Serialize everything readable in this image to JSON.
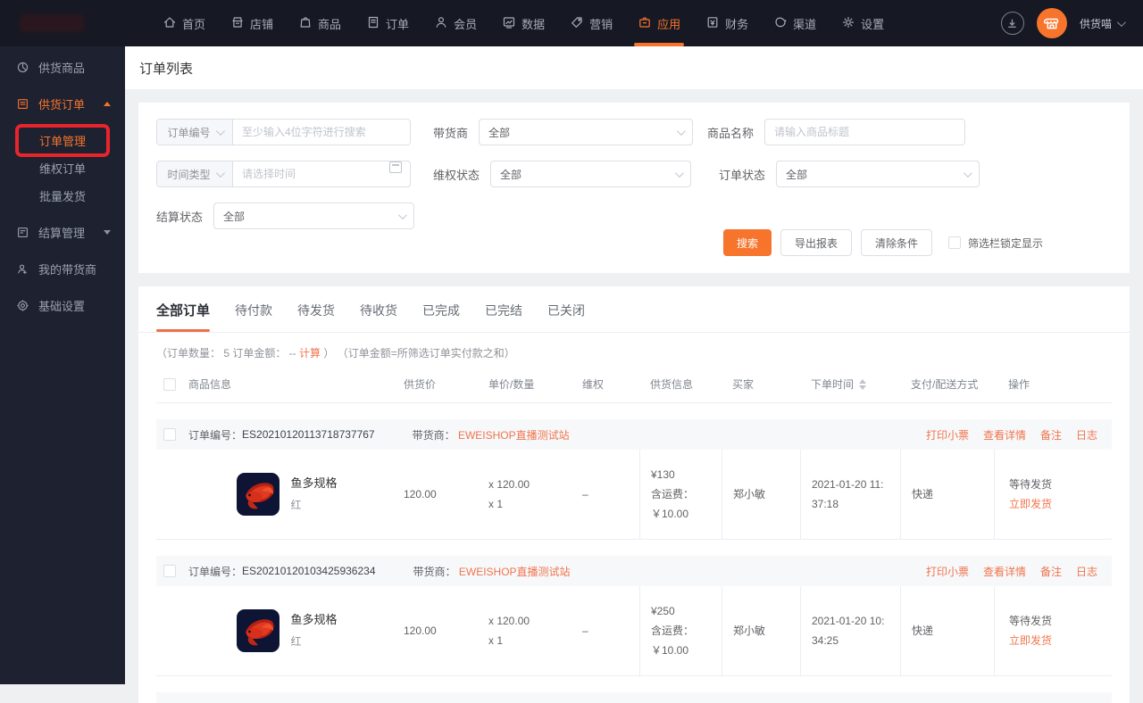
{
  "colors": {
    "accent": "#f7742c",
    "link_orange": "#f0754e",
    "topbar_bg": "#161823",
    "sidebar_bg": "#1d2130",
    "annotation_red": "#e7252b",
    "page_bg": "#eff0f2"
  },
  "topnav": {
    "items": [
      {
        "label": "首页",
        "icon": "home-icon"
      },
      {
        "label": "店铺",
        "icon": "shop-icon"
      },
      {
        "label": "商品",
        "icon": "goods-icon"
      },
      {
        "label": "订单",
        "icon": "order-icon"
      },
      {
        "label": "会员",
        "icon": "member-icon"
      },
      {
        "label": "数据",
        "icon": "data-icon"
      },
      {
        "label": "营销",
        "icon": "marketing-icon"
      },
      {
        "label": "应用",
        "icon": "app-icon",
        "active": true
      },
      {
        "label": "财务",
        "icon": "finance-icon"
      },
      {
        "label": "渠道",
        "icon": "channel-icon"
      },
      {
        "label": "设置",
        "icon": "settings-icon"
      }
    ],
    "user": {
      "name": "供货喵"
    }
  },
  "sidebar": {
    "items": [
      {
        "label": "供货商品"
      },
      {
        "label": "供货订单",
        "expanded": true,
        "active": true
      },
      {
        "label": "订单管理",
        "child": true,
        "active": true,
        "annotated": true
      },
      {
        "label": "维权订单",
        "child": true
      },
      {
        "label": "批量发货",
        "child": true
      },
      {
        "label": "结算管理",
        "collapsed": true
      },
      {
        "label": "我的带货商"
      },
      {
        "label": "基础设置"
      }
    ]
  },
  "page": {
    "title": "订单列表"
  },
  "filters": {
    "order_no": {
      "selector": "订单编号",
      "placeholder": "至少输入4位字符进行搜索"
    },
    "daihuoshang": {
      "label": "带货商",
      "value": "全部"
    },
    "product_name": {
      "label": "商品名称",
      "placeholder": "请输入商品标题"
    },
    "time_type": {
      "selector": "时间类型",
      "placeholder": "请选择时间"
    },
    "weiquan_status": {
      "label": "维权状态",
      "value": "全部"
    },
    "order_status": {
      "label": "订单状态",
      "value": "全部"
    },
    "settle_status": {
      "label": "结算状态",
      "value": "全部"
    },
    "search_button": "搜索",
    "export_button": "导出报表",
    "clear_button": "清除条件",
    "lock_label": "筛选栏锁定显示"
  },
  "tabs": [
    {
      "label": "全部订单",
      "active": true
    },
    {
      "label": "待付款"
    },
    {
      "label": "待发货"
    },
    {
      "label": "待收货"
    },
    {
      "label": "已完成"
    },
    {
      "label": "已完结"
    },
    {
      "label": "已关闭"
    }
  ],
  "summary": {
    "part1": "（订单数量： 5 订单金额： --",
    "calc_link": "计算",
    "part2": "）",
    "part3": "（订单金额=所筛选订单实付款之和）"
  },
  "table": {
    "headers": {
      "product": "商品信息",
      "supply_price": "供货价",
      "unit_qty": "单价/数量",
      "weiquan": "维权",
      "supply_info": "供货信息",
      "buyer": "买家",
      "order_time": "下单时间",
      "pay_delivery": "支付/配送方式",
      "operate": "操作"
    },
    "orders": [
      {
        "order_no_label": "订单编号：",
        "order_no": "ES20210120113718737767",
        "shop_label": "带货商：",
        "shop": "EWEISHOP直播测试站",
        "actions": [
          "打印小票",
          "查看详情",
          "备注",
          "日志"
        ],
        "product": {
          "title": "鱼多规格",
          "spec": "红"
        },
        "supply_price": "120.00",
        "unit_price": "x 120.00",
        "qty": "x 1",
        "weiquan": "–",
        "supply_total": "¥130",
        "freight": "含运费：￥10.00",
        "buyer": "郑小敏",
        "time_line1": "2021-01-20 11:",
        "time_line2": "37:18",
        "delivery": "快递",
        "status": "等待发货",
        "op_link": "立即发货"
      },
      {
        "order_no_label": "订单编号：",
        "order_no": "ES20210120103425936234",
        "shop_label": "带货商：",
        "shop": "EWEISHOP直播测试站",
        "actions": [
          "打印小票",
          "查看详情",
          "备注",
          "日志"
        ],
        "product": {
          "title": "鱼多规格",
          "spec": "红"
        },
        "supply_price": "120.00",
        "unit_price": "x 120.00",
        "qty": "x 1",
        "weiquan": "–",
        "supply_total": "¥250",
        "freight": "含运费：￥10.00",
        "buyer": "郑小敏",
        "time_line1": "2021-01-20 10:",
        "time_line2": "34:25",
        "delivery": "快递",
        "status": "等待发货",
        "op_link": "立即发货"
      }
    ]
  }
}
